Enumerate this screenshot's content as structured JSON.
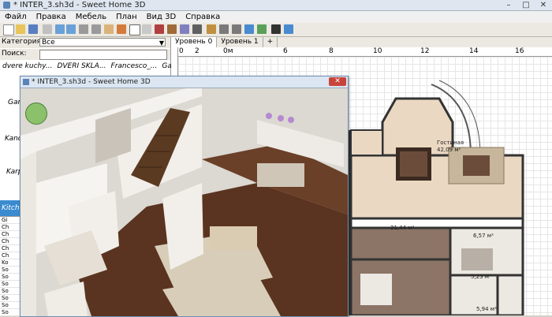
{
  "window": {
    "title": "* INTER_3.sh3d - Sweet Home 3D",
    "controls": [
      "–",
      "□",
      "✕"
    ]
  },
  "menu": [
    "Файл",
    "Правка",
    "Мебель",
    "План",
    "Вид 3D",
    "Справка"
  ],
  "catalog": {
    "category_label": "Категория",
    "category_value": "Все",
    "search_label": "Поиск:",
    "items_row": [
      "dvere kuchy...",
      "DVERI SKLA...",
      "Francesco_...",
      "Gardini"
    ],
    "group_labels": [
      "Gar",
      "Kand",
      "Karp"
    ],
    "selected_item": "Kitch",
    "list_rows": [
      "Gi",
      "Ch",
      "Ch",
      "Ch",
      "Ch",
      "Ch",
      "Ko",
      "So",
      "So",
      "So",
      "So",
      "So",
      "So",
      "So"
    ]
  },
  "plan": {
    "levels": [
      "Уровень 0",
      "Уровень 1",
      "+"
    ],
    "ruler_labels": [
      "0",
      "2",
      "0м",
      "6",
      "8",
      "10",
      "12",
      "14",
      "16"
    ],
    "rooms": [
      {
        "label": "Гостиная",
        "area": "42,09 м²"
      },
      {
        "label": "",
        "area": "21,44 м²"
      },
      {
        "label": "",
        "area": "6,57 м²"
      },
      {
        "label": "",
        "area": "5,23 м²"
      },
      {
        "label": "",
        "area": "5,94 м²"
      }
    ]
  },
  "view3d": {
    "title": "* INTER_3.sh3d - Sweet Home 3D",
    "close": "✕"
  }
}
